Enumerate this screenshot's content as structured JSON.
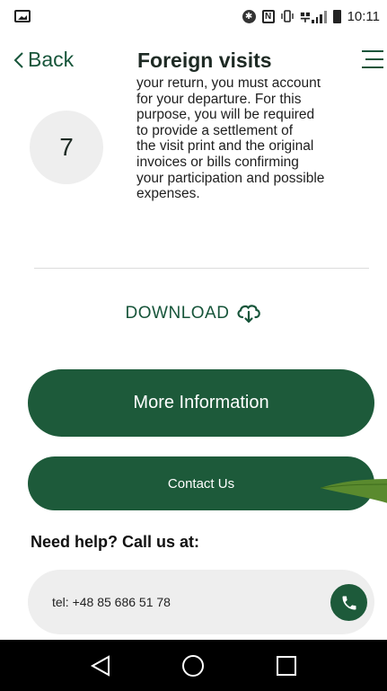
{
  "status_bar": {
    "time": "10:11"
  },
  "header": {
    "back_label": "Back",
    "title": "Foreign visits"
  },
  "step": {
    "number": "7",
    "text": "your return, you must account\nfor your departure. For this\npurpose, you will be required\nto provide a settlement of\nthe visit print and the original\ninvoices or bills confirming\nyour participation and possible\nexpenses."
  },
  "download": {
    "label": "DOWNLOAD"
  },
  "buttons": {
    "more_info": "More Information",
    "contact_us": "Contact Us"
  },
  "help": {
    "title": "Need help? Call us at:",
    "phone": "tel: +48 85 686 51 78"
  },
  "colors": {
    "brand_green": "#1d5a3a",
    "text_green": "#17553a",
    "pill_gray": "#eeeeee"
  }
}
